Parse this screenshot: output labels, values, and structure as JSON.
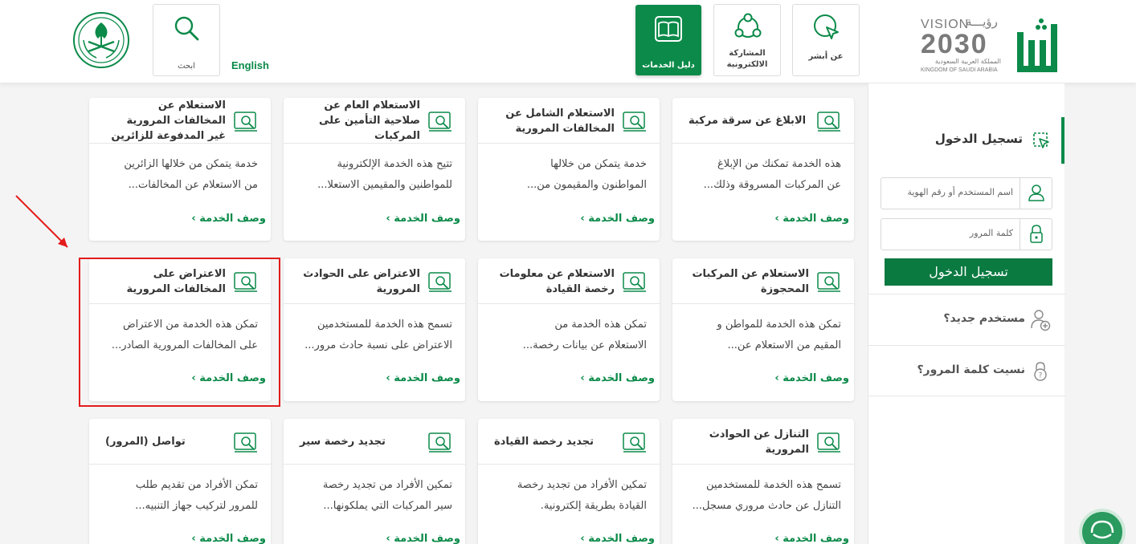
{
  "header": {
    "brand": {
      "vision_label": "VISION",
      "vision_arabic": "رؤيـــة",
      "vision_year": "2030",
      "kingdom_ar": "المملكة العربية السعودية",
      "kingdom_en": "KINGDOM OF SAUDI ARABIA"
    },
    "nav": [
      {
        "label": "عن أبشر",
        "icon": "cursor-click-icon"
      },
      {
        "label": "المشاركة\nالالكترونية",
        "icon": "participation-network-icon"
      },
      {
        "label": "دليل الخدمات",
        "icon": "book-icon",
        "active": true
      }
    ],
    "search": {
      "label": "ابحث",
      "icon": "search-icon"
    },
    "language": "English"
  },
  "sidebar": {
    "login_title": "تسجيل الدخول",
    "username_placeholder": "اسم المستخدم أو رقم الهوية",
    "password_placeholder": "كلمة المرور",
    "login_button": "تسجيل الدخول",
    "new_user": "مستخدم جديد؟",
    "forgot_password": "نسيت كلمة المرور؟"
  },
  "cards": [
    {
      "title": "الابلاغ عن سرقة مركبة",
      "desc1": "هذه الخدمة تمكنك من الإبلاغ",
      "desc2": "عن المركبات المسروقة وذلك...",
      "more": "وصف الخدمة ›"
    },
    {
      "title": "الاستعلام الشامل عن المخالفات المرورية",
      "desc1": "خدمة يتمكن من خلالها",
      "desc2": "المواطنون والمقيمون من...",
      "more": "وصف الخدمة ›"
    },
    {
      "title": "الاستعلام العام عن صلاحية التأمين على المركبات",
      "desc1": "تتيح هذه الخدمة الإلكترونية",
      "desc2": "للمواطنين والمقيمين الاستعلا...",
      "more": "وصف الخدمة ›"
    },
    {
      "title": "الاستعلام عن المخالفات المرورية غير المدفوعة للزائرين",
      "desc1": "خدمة يتمكن من خلالها الزائرين",
      "desc2": "من الاستعلام عن المخالفات...",
      "more": "وصف الخدمة ›"
    },
    {
      "title": "الاستعلام عن المركبات المحجوزة",
      "desc1": "تمكن هذه الخدمة للمواطن و",
      "desc2": "المقيم من الاستعلام عن...",
      "more": "وصف الخدمة ›"
    },
    {
      "title": "الاستعلام عن معلومات رخصة القيادة",
      "desc1": "تمكن هذه الخدمة من",
      "desc2": "الاستعلام عن بيانات رخصة...",
      "more": "وصف الخدمة ›"
    },
    {
      "title": "الاعتراض على الحوادث المرورية",
      "desc1": "تسمح هذه الخدمة للمستخدمين",
      "desc2": "الاعتراض على نسبة حادث مرور...",
      "more": "وصف الخدمة ›"
    },
    {
      "title": "الاعتراض على المخالفات المرورية",
      "desc1": "تمكن هذه الخدمة من الاعتراض",
      "desc2": "على المخالفات المرورية الصادر...",
      "more": "وصف الخدمة ›"
    },
    {
      "title": "التنازل عن الحوادث المرورية",
      "desc1": "تسمح هذه الخدمة للمستخدمين",
      "desc2": "التنازل عن حادث مروري مسجل...",
      "more": "وصف الخدمة ›"
    },
    {
      "title": "تجديد رخصة القيادة",
      "desc1": "تمكين الأفراد من تجديد رخصة",
      "desc2": "القيادة بطريقة إلكترونية.",
      "more": "وصف الخدمة ›"
    },
    {
      "title": "تجديد رخصة سير",
      "desc1": "تمكين الأفراد من تجديد رخصة",
      "desc2": "سير المركبات التي يملكونها...",
      "more": "وصف الخدمة ›"
    },
    {
      "title": "تواصل (المرور)",
      "desc1": "تمكن الأفراد من تقديم طلب",
      "desc2": "للمرور لتركيب جهاز التنبيه...",
      "more": "وصف الخدمة ›"
    }
  ],
  "colors": {
    "brand_green": "#0b8a49",
    "highlight_red": "#e31b1b"
  }
}
